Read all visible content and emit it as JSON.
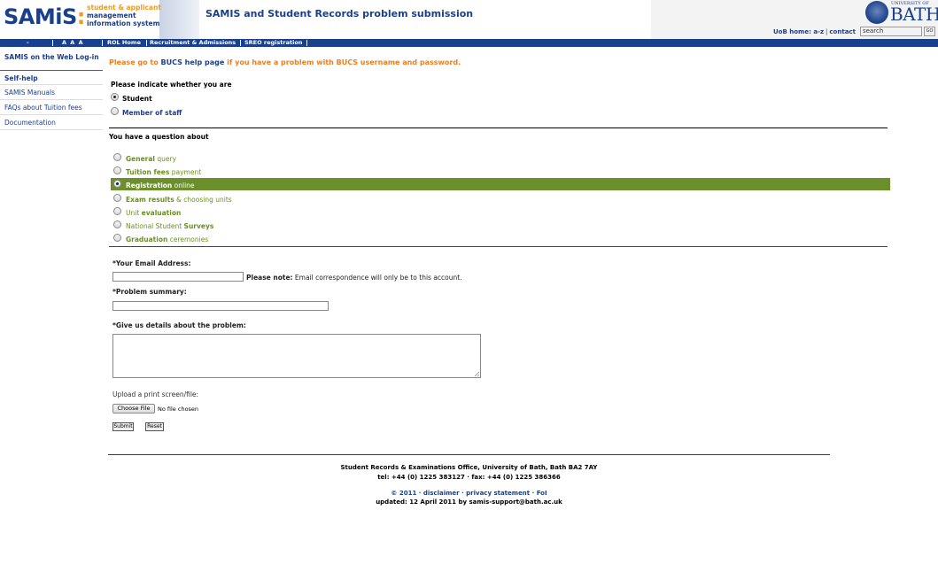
{
  "header": {
    "logo_main": "SAMiS",
    "logo_colon": ":",
    "logo_sub_1": "student & applicant",
    "logo_sub_2": "management",
    "logo_sub_3": "information system",
    "title": "SAMIS and Student Records problem submission",
    "bath_uni": "UNIVERSITY OF",
    "bath_word": "BATH",
    "util_links": [
      "UoB home: a-z",
      "contact"
    ],
    "search_value": "search",
    "go_label": "GO"
  },
  "nav": {
    "minus": "-",
    "text_sizes": "A  A  A",
    "items": [
      "ROL Home",
      "Recruitment & Admissions",
      "SREO registration"
    ]
  },
  "sidebar": {
    "login": "SAMIS on the Web Log-in",
    "self_help": "Self-help",
    "items": [
      "SAMIS Manuals",
      "FAQs about Tuition fees",
      "Documentation"
    ]
  },
  "main": {
    "bucs_pre": "Please go to ",
    "bucs_link": "BUCS help page",
    "bucs_post": " if you have a problem with BUCS username and password.",
    "indicate_label": "Please indicate whether you are",
    "roles": [
      "Student",
      "Member of staff"
    ],
    "selected_role": "Student",
    "question_label": "You have a question about",
    "topics": [
      {
        "bold": "General",
        "rest": " query"
      },
      {
        "bold": "Tuition fees",
        "rest": " payment"
      },
      {
        "bold": "Registration",
        "rest": " online"
      },
      {
        "bold": "Exam results",
        "rest": " & choosing units"
      },
      {
        "pre": "Unit ",
        "bold": "evaluation"
      },
      {
        "pre": "National Student ",
        "bold": "Surveys"
      },
      {
        "bold": "Graduation",
        "rest": " ceremonies"
      }
    ],
    "selected_topic": "Registration online",
    "email_label": "*Your Email Address:",
    "email_value": "",
    "note_bold": "Please note:",
    "note_rest": " Email correspondence will only be to this account.",
    "summary_label": "*Problem summary:",
    "summary_value": "",
    "details_label": "*Give us details about the problem:",
    "upload_label": "Upload a print screen/file:",
    "choose_file": "Choose File",
    "no_file": "No file chosen",
    "submit": "Submit",
    "reset": "Reset"
  },
  "footer": {
    "line1": "Student Records & Examinations Office, University of Bath, Bath BA2 7AY",
    "line2": "tel: +44 (0) 1225 383127 · fax: +44 (0) 1225 386366",
    "copyright": "© 2011 · ",
    "links": [
      "disclaimer",
      "privacy statement",
      "FoI"
    ],
    "updated": "updated: 12 April 2011 by samis-support@bath.ac.uk"
  },
  "colors": {
    "brand_blue": "#1a3f8c",
    "accent_orange": "#f07d1a",
    "highlight_green": "#6b8f2a"
  }
}
